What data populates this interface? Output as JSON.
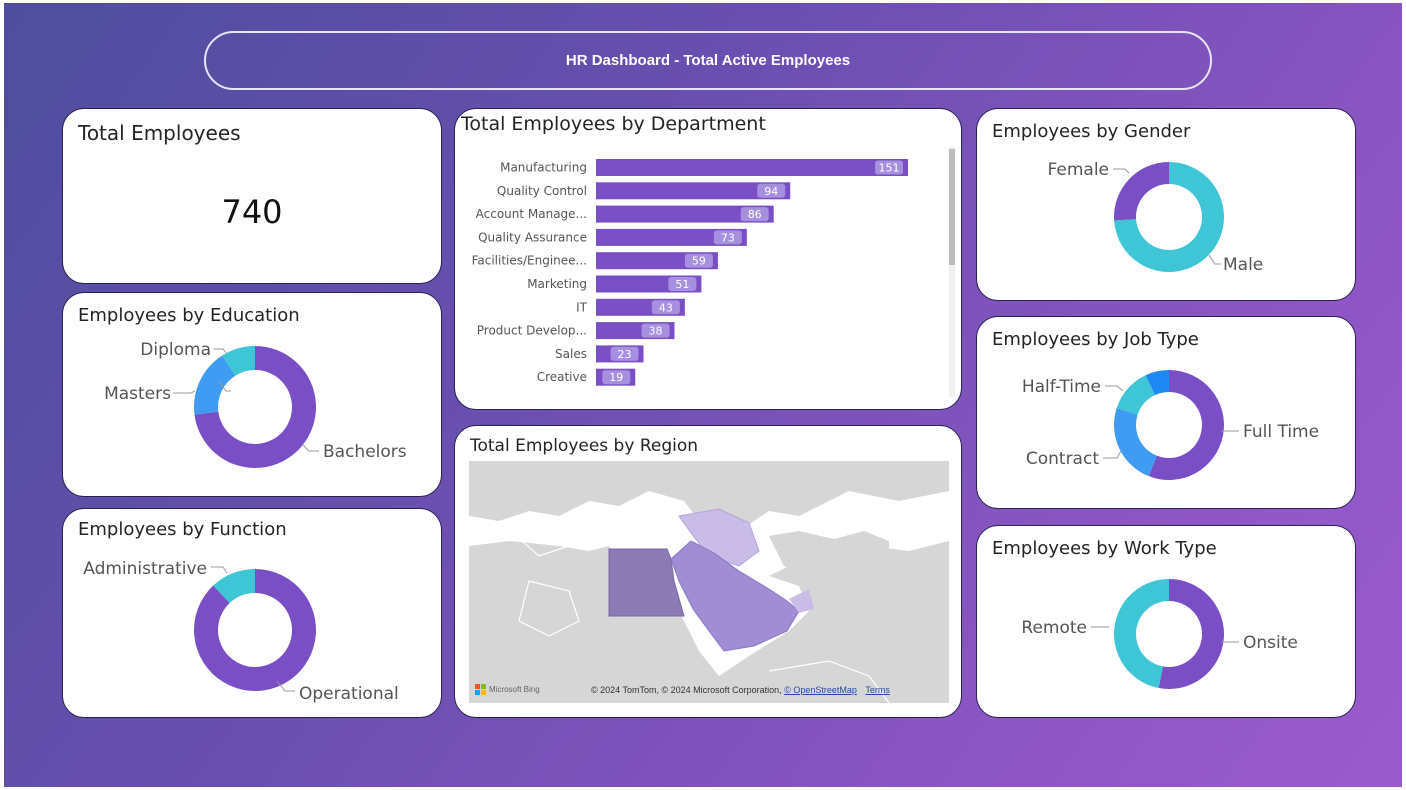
{
  "header": {
    "title": "HR Dashboard - Total Active Employees"
  },
  "kpi": {
    "title": "Total Employees",
    "value": "740"
  },
  "department": {
    "title": "Total Employees by Department",
    "chart_data": {
      "type": "bar",
      "orientation": "horizontal",
      "categories": [
        "Manufacturing",
        "Quality Control",
        "Account Manage...",
        "Quality Assurance",
        "Facilities/Enginee...",
        "Marketing",
        "IT",
        "Product Develop...",
        "Sales",
        "Creative"
      ],
      "values": [
        151,
        94,
        86,
        73,
        59,
        51,
        43,
        38,
        23,
        19
      ],
      "bar_color": "#7a4fc6"
    }
  },
  "region": {
    "title": "Total Employees by Region",
    "logo_text": "Microsoft Bing",
    "attribution": "© 2024 TomTom, © 2024 Microsoft Corporation,",
    "osm_link": "© OpenStreetMap",
    "terms_link": "Terms"
  },
  "education": {
    "title": "Employees by Education",
    "chart_data": {
      "type": "pie",
      "donut": true,
      "categories": [
        "Bachelors",
        "Masters",
        "Diploma"
      ],
      "values": [
        73,
        18,
        9
      ],
      "colors": [
        "#7a4fc6",
        "#3f9cf2",
        "#3ec6d6"
      ]
    }
  },
  "function": {
    "title": "Employees by Function",
    "chart_data": {
      "type": "pie",
      "donut": true,
      "categories": [
        "Operational",
        "Administrative"
      ],
      "values": [
        88,
        12
      ],
      "colors": [
        "#7a4fc6",
        "#3ec6d6"
      ]
    }
  },
  "gender": {
    "title": "Employees by Gender",
    "chart_data": {
      "type": "pie",
      "donut": true,
      "categories": [
        "Male",
        "Female"
      ],
      "values": [
        74,
        26
      ],
      "colors": [
        "#3ec6d6",
        "#7a4fc6"
      ]
    }
  },
  "jobtype": {
    "title": "Employees by Job Type",
    "chart_data": {
      "type": "pie",
      "donut": true,
      "categories": [
        "Full Time",
        "Contract",
        "Half-Time",
        ""
      ],
      "values": [
        56,
        24,
        13,
        7
      ],
      "colors": [
        "#7a4fc6",
        "#3f9cf2",
        "#3ec6d6",
        "#1e88f5"
      ]
    }
  },
  "worktype": {
    "title": "Employees by Work Type",
    "chart_data": {
      "type": "pie",
      "donut": true,
      "categories": [
        "Onsite",
        "Remote"
      ],
      "values": [
        53,
        47
      ],
      "colors": [
        "#7a4fc6",
        "#3ec6d6"
      ]
    }
  }
}
